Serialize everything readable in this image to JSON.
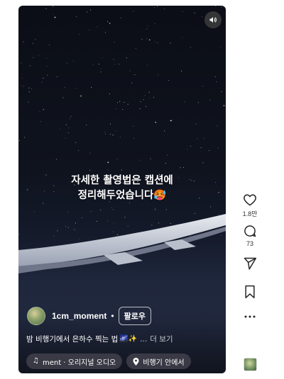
{
  "video": {
    "overlay_lines": [
      "자세한 촬영법은 캡션에",
      "정리해두었습니다"
    ],
    "overlay_emoji": "🥵",
    "mute_icon": "speaker-on-icon"
  },
  "author": {
    "username": "1cm_moment",
    "separator": "•",
    "follow_label": "팔로우"
  },
  "caption": {
    "text": "밤 비행기에서 은하수 찍는 법",
    "emoji": "🌌✨",
    "ellipsis": "...",
    "more_label": "더 보기"
  },
  "chips": {
    "audio_label": "ment · 오리지널 오디오",
    "audio_icon": "music-note-icon",
    "location_label": "비행기 안에서",
    "location_icon": "location-pin-icon"
  },
  "actions": {
    "like_count": "1.8만",
    "comment_count": "73",
    "like_icon": "heart-icon",
    "comment_icon": "comment-icon",
    "share_icon": "send-icon",
    "save_icon": "bookmark-icon",
    "more_icon": "more-icon"
  },
  "colors": {
    "video_bg": "#0f131e",
    "text_on_video": "#ffffff",
    "icon": "#262626"
  }
}
